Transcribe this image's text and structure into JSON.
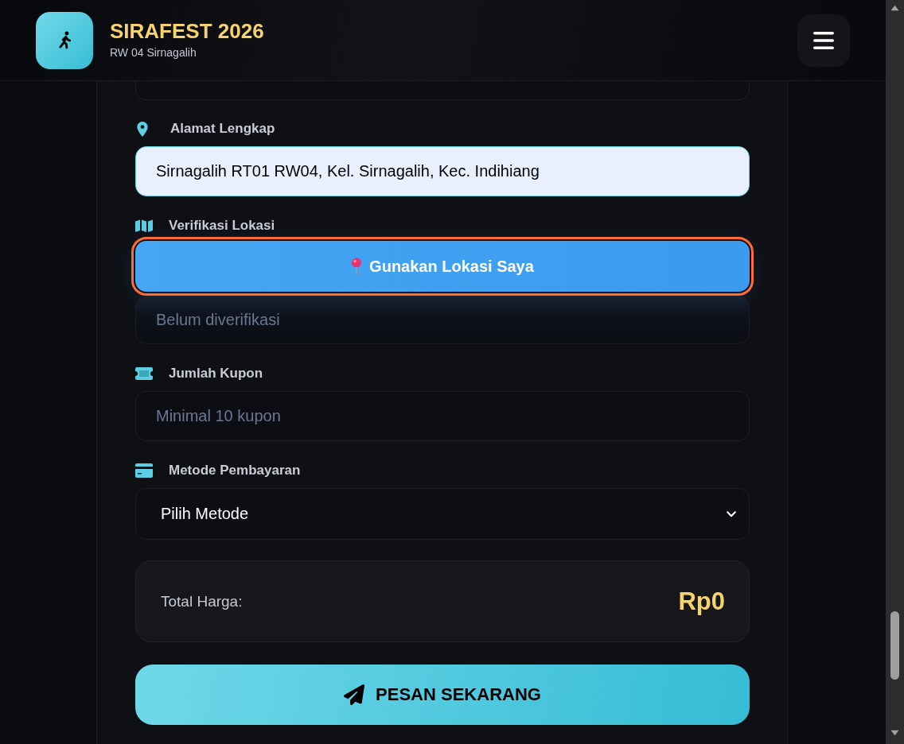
{
  "header": {
    "title": "SIRAFEST 2026",
    "subtitle": "RW 04 Sirnagalih"
  },
  "form": {
    "fields": [
      {
        "kind": "input",
        "label": "Alamat Lengkap",
        "value": "Sirnagalih RT01 RW04, Kel. Sirnagalih, Kec. Indihiang",
        "autofilled": true
      },
      {
        "kind": "location",
        "label": "Verifikasi Lokasi",
        "button": "Gunakan Lokasi Saya",
        "focused": true,
        "status_placeholder": "Belum diverifikasi"
      },
      {
        "kind": "input",
        "label": "Jumlah Kupon",
        "placeholder": "Minimal 10 kupon",
        "autofilled": false
      },
      {
        "kind": "select",
        "label": "Metode Pembayaran",
        "value": "Pilih Metode"
      }
    ]
  },
  "total": {
    "label": "Total Harga:",
    "value": "Rp0"
  },
  "submit": {
    "label": "PESAN SEKARANG"
  }
}
